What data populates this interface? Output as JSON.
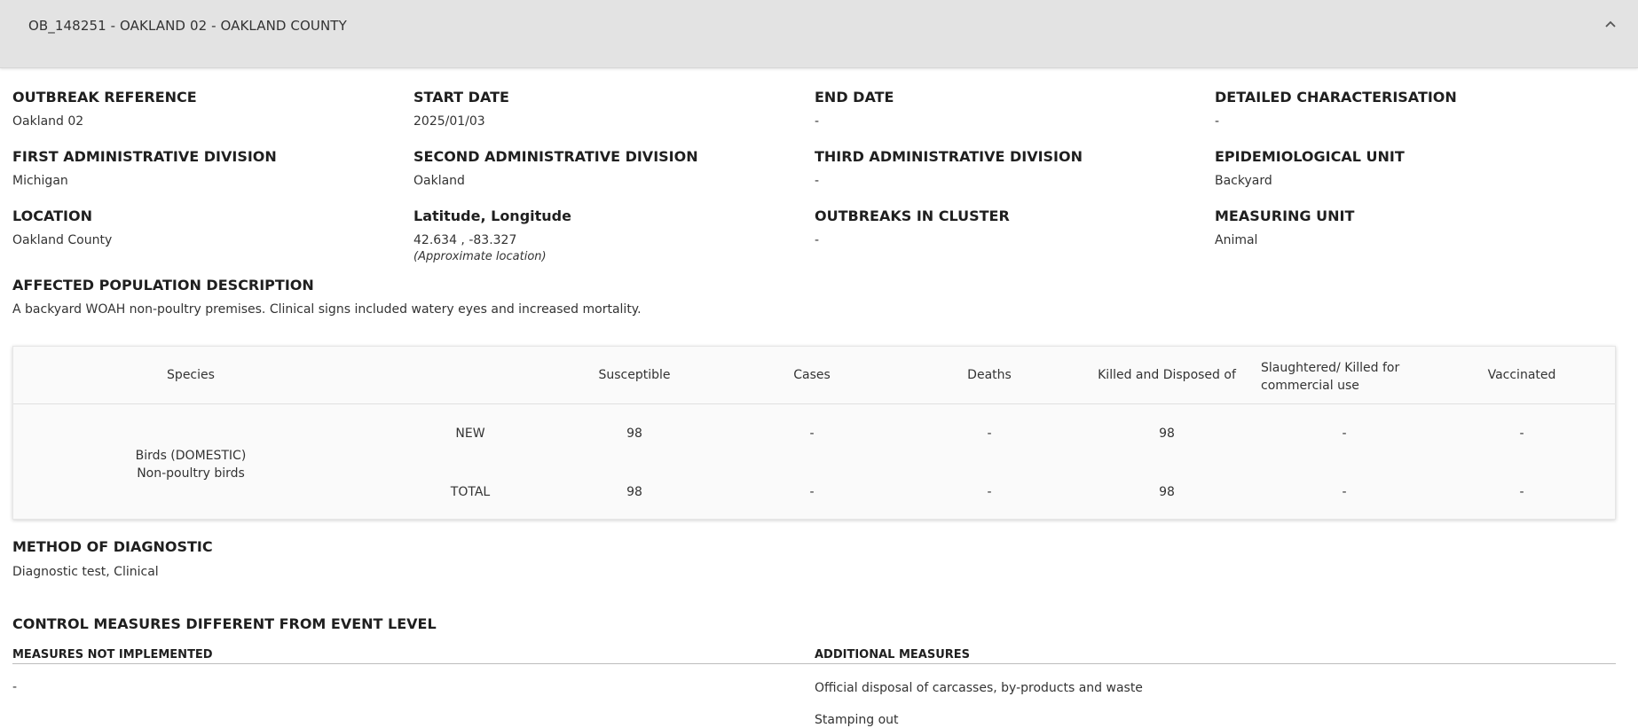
{
  "header": {
    "title": "OB_148251 - OAKLAND 02 - OAKLAND COUNTY",
    "collapse_icon": "chevron-up-icon"
  },
  "fields": {
    "outbreak_reference": {
      "label": "OUTBREAK REFERENCE",
      "value": "Oakland 02"
    },
    "start_date": {
      "label": "START DATE",
      "value": "2025/01/03"
    },
    "end_date": {
      "label": "END DATE",
      "value": "-"
    },
    "detailed_characterisation": {
      "label": "DETAILED CHARACTERISATION",
      "value": "-"
    },
    "first_admin_division": {
      "label": "FIRST ADMINISTRATIVE DIVISION",
      "value": "Michigan"
    },
    "second_admin_division": {
      "label": "SECOND ADMINISTRATIVE DIVISION",
      "value": "Oakland"
    },
    "third_admin_division": {
      "label": "THIRD ADMINISTRATIVE DIVISION",
      "value": "-"
    },
    "epidemiological_unit": {
      "label": "EPIDEMIOLOGICAL UNIT",
      "value": "Backyard"
    },
    "location": {
      "label": "LOCATION",
      "value": "Oakland County"
    },
    "lat_long": {
      "label": "Latitude, Longitude",
      "value": "42.634 , -83.327",
      "note": "(Approximate location)"
    },
    "outbreaks_in_cluster": {
      "label": "OUTBREAKS IN CLUSTER",
      "value": "-"
    },
    "measuring_unit": {
      "label": "MEASURING UNIT",
      "value": "Animal"
    },
    "affected_population": {
      "label": "AFFECTED POPULATION DESCRIPTION",
      "value": "A backyard WOAH non-poultry premises. Clinical signs included watery eyes and increased mortality."
    }
  },
  "species_table": {
    "columns": {
      "species": "Species",
      "susceptible": "Susceptible",
      "cases": "Cases",
      "deaths": "Deaths",
      "killed": "Killed and Disposed of",
      "slaughtered": "Slaughtered/ Killed for commercial use",
      "vaccinated": "Vaccinated"
    },
    "species_line1": "Birds (DOMESTIC)",
    "species_line2": "Non-poultry birds",
    "rows": [
      {
        "type": "NEW",
        "susceptible": "98",
        "cases": "-",
        "deaths": "-",
        "killed": "98",
        "slaughtered": "-",
        "vaccinated": "-"
      },
      {
        "type": "TOTAL",
        "susceptible": "98",
        "cases": "-",
        "deaths": "-",
        "killed": "98",
        "slaughtered": "-",
        "vaccinated": "-"
      }
    ]
  },
  "diagnostic": {
    "label": "METHOD OF DIAGNOSTIC",
    "value": "Diagnostic test, Clinical"
  },
  "control_measures": {
    "title": "CONTROL MEASURES DIFFERENT FROM EVENT LEVEL",
    "not_implemented_label": "MEASURES NOT IMPLEMENTED",
    "not_implemented_value": "-",
    "additional_label": "ADDITIONAL MEASURES",
    "additional_items": [
      "Official disposal of carcasses, by-products and waste",
      "Stamping out"
    ]
  }
}
